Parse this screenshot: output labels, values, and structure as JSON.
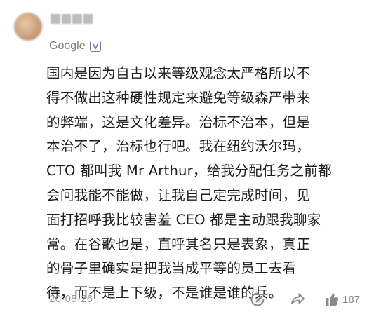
{
  "post": {
    "author": {
      "company": "Google",
      "icons": {
        "verified": "verified-badge-icon"
      }
    },
    "lines": [
      "国内是因为自古以来等级观念太严格所以不",
      "得不做出这种硬性规定来避免等级森严带来",
      "的弊端，这是文化差异。治标不治本，但是",
      "本治不了，治标也行吧。我在纽约沃尔玛，",
      "CTO 都叫我 Mr Arthur，给我分配任务之前都",
      "会问我能不能做，让我自己定完成时间，见",
      "面打招呼我比较害羞 CEO 都是主动跟我聊家",
      "常。在谷歌也是，直呼其名只是表象，真正",
      "的骨子里确实是把我当成平等的员工去看",
      "待，而不是上下级，不是谁是谁的兵。"
    ],
    "date": "20-05-26",
    "actions": {
      "edit_icon": "pencil-circle-icon",
      "share_icon": "share-arrow-icon",
      "like_icon": "thumbs-up-icon",
      "like_count": "187"
    },
    "colors": {
      "text": "#1e1e1e",
      "muted": "#9a9a9a",
      "icon": "#8a8a8a",
      "badge": "#6f7fb0"
    }
  }
}
